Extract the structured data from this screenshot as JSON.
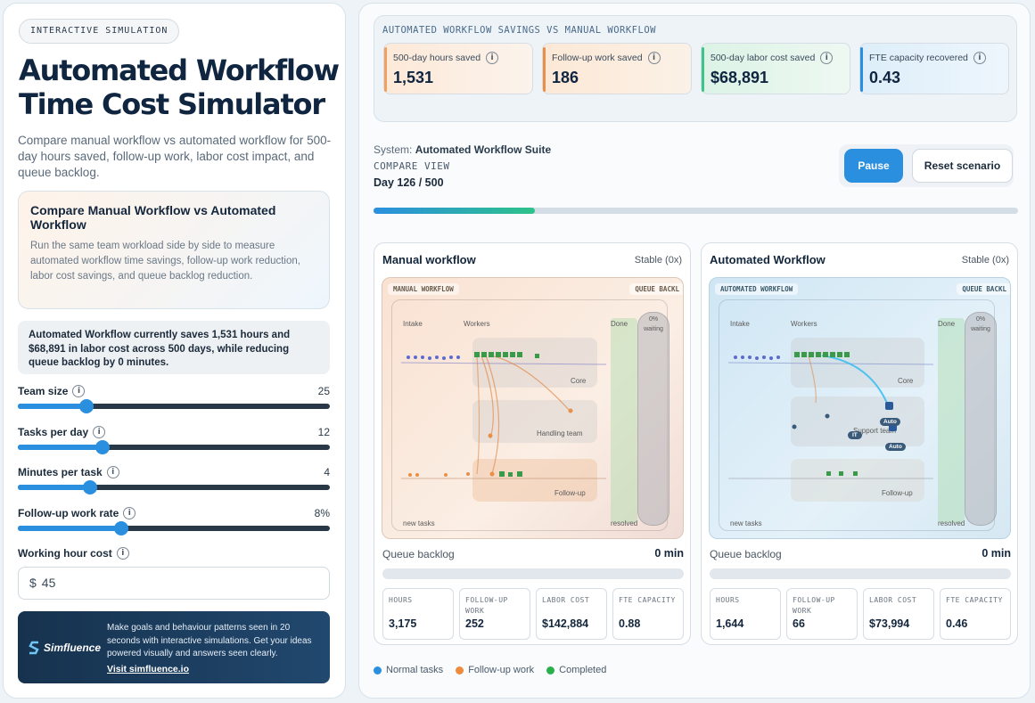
{
  "left": {
    "badge": "INTERACTIVE SIMULATION",
    "title": "Automated Workflow Time Cost Simulator",
    "subtitle": "Compare manual workflow vs automated workflow for 500-day hours saved, follow-up work, labor cost impact, and queue backlog.",
    "card": {
      "title": "Compare Manual Workflow vs Automated Workflow",
      "body": "Run the same team workload side by side to measure automated workflow time savings, follow-up work reduction, labor cost savings, and queue backlog reduction."
    },
    "summary": "Automated Workflow currently saves 1,531 hours and $68,891 in labor cost across 500 days, while reducing queue backlog by 0 minutes.",
    "sliders": [
      {
        "label": "Team size",
        "value": "25",
        "fraction": 0.22
      },
      {
        "label": "Tasks per day",
        "value": "12",
        "fraction": 0.27
      },
      {
        "label": "Minutes per task",
        "value": "4",
        "fraction": 0.23
      },
      {
        "label": "Follow-up work rate",
        "value": "8%",
        "fraction": 0.33
      }
    ],
    "cost": {
      "label": "Working hour cost",
      "currency": "$",
      "value": "45"
    },
    "promo": {
      "logo": "Simfluence",
      "text": "Make goals and behaviour patterns seen in 20 seconds with interactive simulations. Get your ideas powered visually and answers seen clearly.",
      "link": "Visit simfluence.io"
    }
  },
  "right": {
    "header_title": "AUTOMATED WORKFLOW SAVINGS VS MANUAL WORKFLOW",
    "kpis": [
      {
        "label": "500-day hours saved",
        "value": "1,531",
        "accent": "#f0a060"
      },
      {
        "label": "Follow-up work saved",
        "value": "186",
        "accent": "#e8904a"
      },
      {
        "label": "500-day labor cost saved",
        "value": "$68,891",
        "accent": "#3cc48a"
      },
      {
        "label": "FTE capacity recovered",
        "value": "0.43",
        "accent": "#2b8fe0"
      }
    ],
    "system_label": "System:",
    "system_name": "Automated Workflow Suite",
    "compare_view": "COMPARE VIEW",
    "day": "Day 126 / 500",
    "progress_fraction": 0.25,
    "pause_label": "Pause",
    "reset_label": "Reset scenario",
    "manual": {
      "title": "Manual workflow",
      "status": "Stable (0x)",
      "viz_tag": "MANUAL WORKFLOW",
      "queue_tag": "QUEUE BACKL",
      "intake": "Intake",
      "workers": "Workers",
      "done": "Done",
      "waiting_pct": "0%",
      "waiting": "waiting",
      "core": "Core",
      "handling": "Handling team",
      "followup": "Follow-up",
      "new_tasks": "new tasks",
      "resolved": "resolved",
      "queue_label": "Queue backlog",
      "queue_value": "0 min",
      "stats": [
        {
          "label": "HOURS",
          "value": "3,175"
        },
        {
          "label": "FOLLOW-UP WORK",
          "value": "252"
        },
        {
          "label": "LABOR COST",
          "value": "$142,884"
        },
        {
          "label": "FTE CAPACITY",
          "value": "0.88"
        }
      ]
    },
    "automated": {
      "title": "Automated Workflow",
      "status": "Stable (0x)",
      "viz_tag": "AUTOMATED WORKFLOW",
      "queue_tag": "QUEUE BACKL",
      "intake": "Intake",
      "workers": "Workers",
      "done": "Done",
      "waiting_pct": "0%",
      "waiting": "waiting",
      "core": "Core",
      "support": "Support team",
      "followup": "Follow-up",
      "it_chip": "IT",
      "auto_chip": "Auto",
      "new_tasks": "new tasks",
      "resolved": "resolved",
      "queue_label": "Queue backlog",
      "queue_value": "0 min",
      "stats": [
        {
          "label": "HOURS",
          "value": "1,644"
        },
        {
          "label": "FOLLOW-UP WORK",
          "value": "66"
        },
        {
          "label": "LABOR COST",
          "value": "$73,994"
        },
        {
          "label": "FTE CAPACITY",
          "value": "0.46"
        }
      ]
    },
    "legend": [
      {
        "label": "Normal tasks",
        "color": "#2b8fe0"
      },
      {
        "label": "Follow-up work",
        "color": "#f08a3c"
      },
      {
        "label": "Completed",
        "color": "#2ab04a"
      }
    ]
  }
}
